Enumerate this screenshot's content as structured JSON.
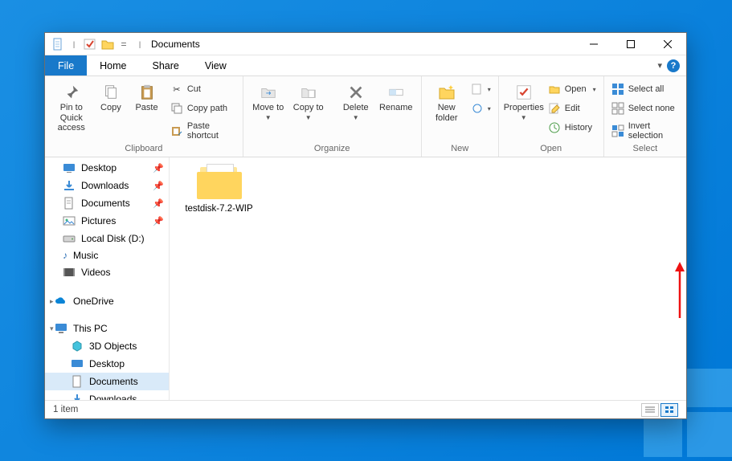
{
  "title": "Documents",
  "tabs": {
    "file": "File",
    "home": "Home",
    "share": "Share",
    "view": "View"
  },
  "ribbon": {
    "clipboard": {
      "label": "Clipboard",
      "pin": "Pin to Quick access",
      "copy": "Copy",
      "paste": "Paste",
      "cut": "Cut",
      "copy_path": "Copy path",
      "paste_shortcut": "Paste shortcut"
    },
    "organize": {
      "label": "Organize",
      "move_to": "Move to",
      "copy_to": "Copy to",
      "delete": "Delete",
      "rename": "Rename"
    },
    "new": {
      "label": "New",
      "new_folder": "New folder"
    },
    "open": {
      "label": "Open",
      "properties": "Properties",
      "open": "Open",
      "edit": "Edit",
      "history": "History"
    },
    "select": {
      "label": "Select",
      "select_all": "Select all",
      "select_none": "Select none",
      "invert": "Invert selection"
    }
  },
  "nav": {
    "desktop": "Desktop",
    "downloads": "Downloads",
    "documents": "Documents",
    "pictures": "Pictures",
    "local_disk": "Local Disk (D:)",
    "music": "Music",
    "videos": "Videos",
    "onedrive": "OneDrive",
    "this_pc": "This PC",
    "objects3d": "3D Objects",
    "desktop2": "Desktop",
    "documents2": "Documents",
    "downloads2": "Downloads"
  },
  "content": {
    "items": [
      {
        "name": "testdisk-7.2-WIP"
      }
    ]
  },
  "status": {
    "count": "1 item"
  }
}
